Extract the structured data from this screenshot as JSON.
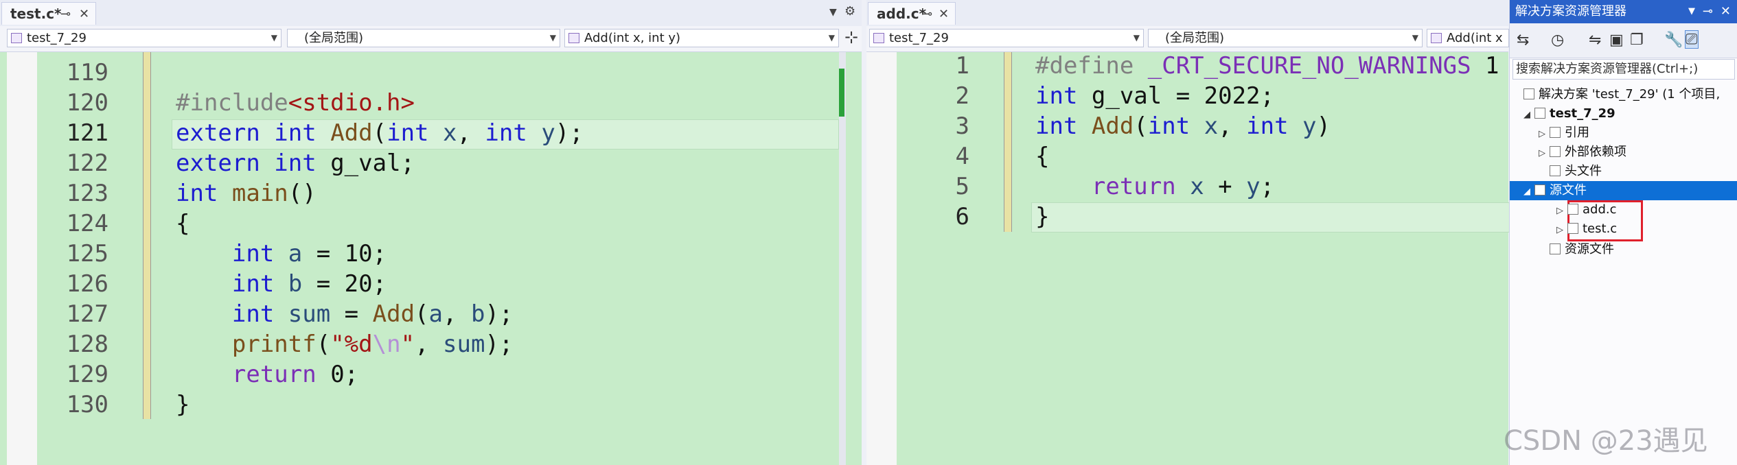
{
  "left_editor": {
    "tab": "test.c*",
    "project": "test_7_29",
    "scope": "(全局范围)",
    "member": "Add(int x, int y)",
    "lines": [
      {
        "no": "119",
        "tokens": []
      },
      {
        "no": "120",
        "tokens": [
          {
            "t": "#include",
            "c": "pp"
          },
          {
            "t": "<stdio.h>",
            "c": "str"
          }
        ]
      },
      {
        "no": "121",
        "tokens": [
          {
            "t": "extern ",
            "c": "kw"
          },
          {
            "t": "int ",
            "c": "kw"
          },
          {
            "t": "Add",
            "c": "fn"
          },
          {
            "t": "(",
            "c": "plain"
          },
          {
            "t": "int ",
            "c": "kw"
          },
          {
            "t": "x",
            "c": "id"
          },
          {
            "t": ", ",
            "c": "plain"
          },
          {
            "t": "int ",
            "c": "kw"
          },
          {
            "t": "y",
            "c": "id"
          },
          {
            "t": ");",
            "c": "plain"
          }
        ]
      },
      {
        "no": "122",
        "tokens": [
          {
            "t": "extern ",
            "c": "kw"
          },
          {
            "t": "int ",
            "c": "kw"
          },
          {
            "t": "g_val;",
            "c": "plain"
          }
        ]
      },
      {
        "no": "123",
        "tokens": [
          {
            "t": "int ",
            "c": "kw"
          },
          {
            "t": "main",
            "c": "fn"
          },
          {
            "t": "()",
            "c": "plain"
          }
        ]
      },
      {
        "no": "124",
        "tokens": [
          {
            "t": "{",
            "c": "plain"
          }
        ]
      },
      {
        "no": "125",
        "tokens": [
          {
            "t": "    ",
            "c": "plain"
          },
          {
            "t": "int ",
            "c": "kw"
          },
          {
            "t": "a",
            "c": "id"
          },
          {
            "t": " = 10;",
            "c": "plain"
          }
        ]
      },
      {
        "no": "126",
        "tokens": [
          {
            "t": "    ",
            "c": "plain"
          },
          {
            "t": "int ",
            "c": "kw"
          },
          {
            "t": "b",
            "c": "id"
          },
          {
            "t": " = 20;",
            "c": "plain"
          }
        ]
      },
      {
        "no": "127",
        "tokens": [
          {
            "t": "    ",
            "c": "plain"
          },
          {
            "t": "int ",
            "c": "kw"
          },
          {
            "t": "sum",
            "c": "id"
          },
          {
            "t": " = ",
            "c": "plain"
          },
          {
            "t": "Add",
            "c": "fn"
          },
          {
            "t": "(",
            "c": "plain"
          },
          {
            "t": "a",
            "c": "id"
          },
          {
            "t": ", ",
            "c": "plain"
          },
          {
            "t": "b",
            "c": "id"
          },
          {
            "t": ");",
            "c": "plain"
          }
        ]
      },
      {
        "no": "128",
        "tokens": [
          {
            "t": "    ",
            "c": "plain"
          },
          {
            "t": "printf",
            "c": "fn"
          },
          {
            "t": "(",
            "c": "plain"
          },
          {
            "t": "\"%d",
            "c": "str"
          },
          {
            "t": "\\n",
            "c": "esc"
          },
          {
            "t": "\"",
            "c": "str"
          },
          {
            "t": ", ",
            "c": "plain"
          },
          {
            "t": "sum",
            "c": "id"
          },
          {
            "t": ");",
            "c": "plain"
          }
        ]
      },
      {
        "no": "129",
        "tokens": [
          {
            "t": "    ",
            "c": "plain"
          },
          {
            "t": "return ",
            "c": "kw2"
          },
          {
            "t": "0;",
            "c": "plain"
          }
        ]
      },
      {
        "no": "130",
        "tokens": [
          {
            "t": "}",
            "c": "plain"
          }
        ]
      }
    ]
  },
  "right_editor": {
    "tab": "add.c*",
    "project": "test_7_29",
    "scope": "(全局范围)",
    "member": "Add(int x",
    "lines": [
      {
        "no": "1",
        "tokens": [
          {
            "t": "#define ",
            "c": "pp"
          },
          {
            "t": "_CRT_SECURE_NO_WARNINGS",
            "c": "mac"
          },
          {
            "t": " 1",
            "c": "plain"
          }
        ]
      },
      {
        "no": "2",
        "tokens": [
          {
            "t": "int ",
            "c": "kw"
          },
          {
            "t": "g_val = 2022;",
            "c": "plain"
          }
        ]
      },
      {
        "no": "3",
        "tokens": [
          {
            "t": "int ",
            "c": "kw"
          },
          {
            "t": "Add",
            "c": "fn"
          },
          {
            "t": "(",
            "c": "plain"
          },
          {
            "t": "int ",
            "c": "kw"
          },
          {
            "t": "x",
            "c": "id"
          },
          {
            "t": ", ",
            "c": "plain"
          },
          {
            "t": "int ",
            "c": "kw"
          },
          {
            "t": "y",
            "c": "id"
          },
          {
            "t": ")",
            "c": "plain"
          }
        ]
      },
      {
        "no": "4",
        "tokens": [
          {
            "t": "{",
            "c": "plain"
          }
        ]
      },
      {
        "no": "5",
        "tokens": [
          {
            "t": "    ",
            "c": "plain"
          },
          {
            "t": "return ",
            "c": "kw2"
          },
          {
            "t": "x",
            "c": "id"
          },
          {
            "t": " + ",
            "c": "plain"
          },
          {
            "t": "y",
            "c": "id"
          },
          {
            "t": ";",
            "c": "plain"
          }
        ]
      },
      {
        "no": "6",
        "tokens": [
          {
            "t": "}",
            "c": "plain"
          }
        ]
      }
    ]
  },
  "solution_explorer": {
    "title": "解决方案资源管理器",
    "search_placeholder": "搜索解决方案资源管理器(Ctrl+;)",
    "solution": "解决方案 'test_7_29' (1 个项目,",
    "project": "test_7_29",
    "references": "引用",
    "external": "外部依赖项",
    "headers": "头文件",
    "sources": "源文件",
    "file1": "add.c",
    "file2": "test.c",
    "resources": "资源文件"
  },
  "watermark": "CSDN @23遇见"
}
